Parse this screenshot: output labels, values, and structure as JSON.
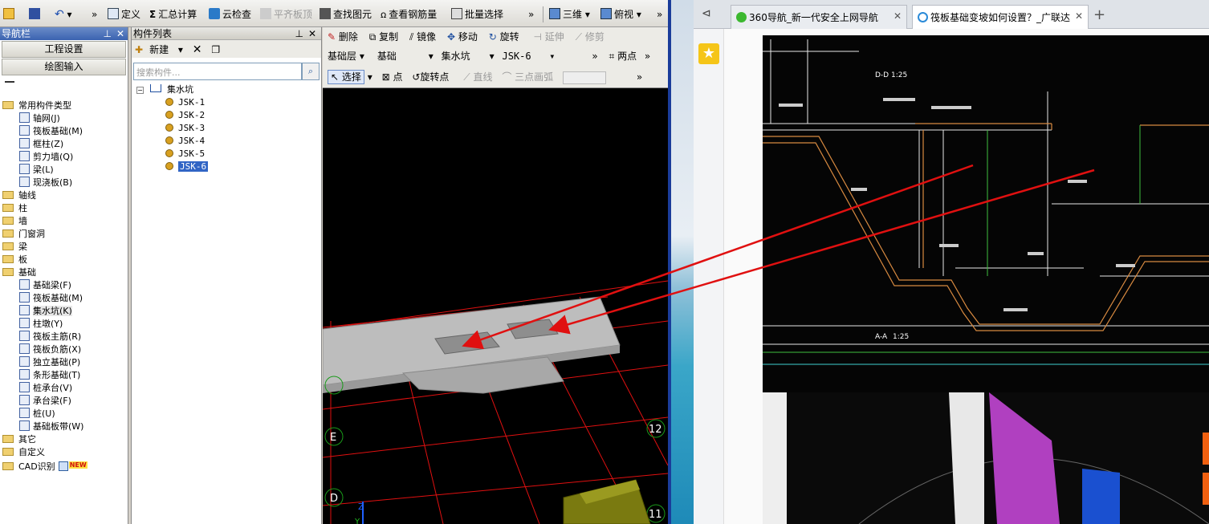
{
  "toolbar": {
    "define": "定义",
    "sum_calc": "汇总计算",
    "cloud_check": "云检查",
    "flat_slab_top": "平齐板顶",
    "find_element": "查找图元",
    "view_rebar": "查看钢筋量",
    "batch_select": "批量选择",
    "view_3d": "三维",
    "top_view": "俯视"
  },
  "nav_panel": {
    "title": "导航栏",
    "project_settings": "工程设置",
    "drawing_input": "绘图输入",
    "tree": [
      {
        "label": "常用构件类型",
        "type": "folder"
      },
      {
        "label": "轴网(J)",
        "type": "leaf"
      },
      {
        "label": "筏板基础(M)",
        "type": "leaf"
      },
      {
        "label": "框柱(Z)",
        "type": "leaf"
      },
      {
        "label": "剪力墙(Q)",
        "type": "leaf"
      },
      {
        "label": "梁(L)",
        "type": "leaf"
      },
      {
        "label": "现浇板(B)",
        "type": "leaf"
      },
      {
        "label": "轴线",
        "type": "folder"
      },
      {
        "label": "柱",
        "type": "folder"
      },
      {
        "label": "墙",
        "type": "folder"
      },
      {
        "label": "门窗洞",
        "type": "folder"
      },
      {
        "label": "梁",
        "type": "folder"
      },
      {
        "label": "板",
        "type": "folder"
      },
      {
        "label": "基础",
        "type": "folder"
      },
      {
        "label": "基础梁(F)",
        "type": "leaf"
      },
      {
        "label": "筏板基础(M)",
        "type": "leaf"
      },
      {
        "label": "集水坑(K)",
        "type": "leaf",
        "selected": true
      },
      {
        "label": "柱墩(Y)",
        "type": "leaf"
      },
      {
        "label": "筏板主筋(R)",
        "type": "leaf"
      },
      {
        "label": "筏板负筋(X)",
        "type": "leaf"
      },
      {
        "label": "独立基础(P)",
        "type": "leaf"
      },
      {
        "label": "条形基础(T)",
        "type": "leaf"
      },
      {
        "label": "桩承台(V)",
        "type": "leaf"
      },
      {
        "label": "承台梁(F)",
        "type": "leaf"
      },
      {
        "label": "桩(U)",
        "type": "leaf"
      },
      {
        "label": "基础板带(W)",
        "type": "leaf"
      },
      {
        "label": "其它",
        "type": "folder"
      },
      {
        "label": "自定义",
        "type": "folder"
      },
      {
        "label": "CAD识别",
        "type": "folder",
        "badge": "NEW"
      }
    ]
  },
  "comp_panel": {
    "title": "构件列表",
    "new_label": "新建",
    "search_placeholder": "搜索构件...",
    "root": "集水坑",
    "items": [
      "JSK-1",
      "JSK-2",
      "JSK-3",
      "JSK-4",
      "JSK-5",
      "JSK-6"
    ],
    "selected": "JSK-6"
  },
  "cad_toolbar": {
    "delete": "删除",
    "copy": "复制",
    "mirror": "镜像",
    "move": "移动",
    "rotate": "旋转",
    "extend": "延伸",
    "trim": "修剪",
    "layer": "基础层",
    "category": "基础",
    "type": "集水坑",
    "component": "JSK-6",
    "two_point": "两点",
    "select": "选择",
    "point": "点",
    "rotate_point": "旋转点",
    "line": "直线",
    "three_point_arc": "三点画弧"
  },
  "cad_view": {
    "axis_labels": [
      "E",
      "D",
      "12",
      "11"
    ],
    "axis_z": "Z",
    "axis_y": "Y"
  },
  "browser": {
    "tabs": [
      {
        "title": "360导航_新一代安全上网导航",
        "active": false
      },
      {
        "title": "筏板基础变坡如何设置？_广联达",
        "active": true
      }
    ]
  },
  "photo": {
    "labels": [
      "D-D",
      "1:25",
      "A-A",
      "1:25"
    ]
  },
  "colors": {
    "nav_title": "#3a62b0",
    "selection": "#3165c5",
    "annotation_arrow": "#e01010",
    "cad_grid": "#e01010",
    "cad_slab": "#bdbdbd"
  }
}
